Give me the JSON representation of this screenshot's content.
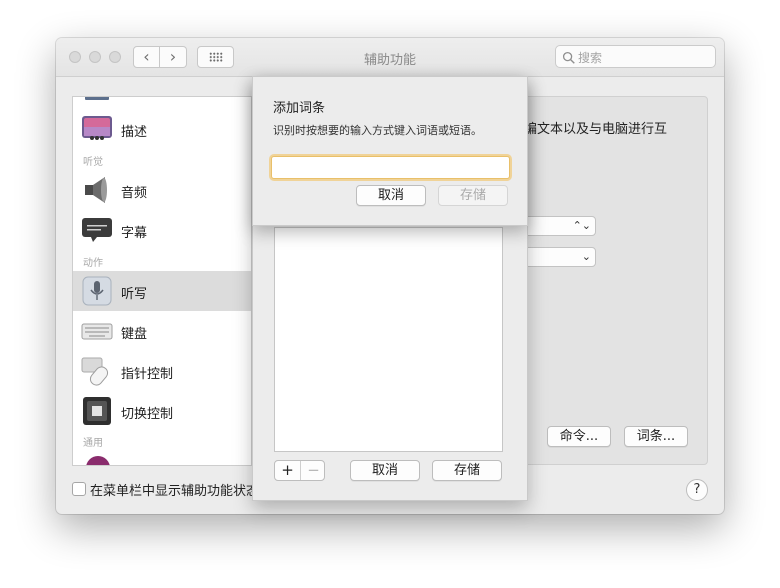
{
  "window": {
    "title": "辅助功能"
  },
  "toolbar": {
    "back_glyph": "‹",
    "forward_glyph": "›"
  },
  "search": {
    "placeholder": "搜索"
  },
  "sidebar": {
    "sections": {
      "vision": "听觉",
      "motor": "动作",
      "general": "通用"
    },
    "items": [
      {
        "label": "描述",
        "icon": "description-icon"
      },
      {
        "label": "音频",
        "icon": "speaker-icon"
      },
      {
        "label": "字幕",
        "icon": "captions-icon"
      },
      {
        "label": "听写",
        "icon": "microphone-icon",
        "selected": true
      },
      {
        "label": "键盘",
        "icon": "keyboard-icon"
      },
      {
        "label": "指针控制",
        "icon": "mouse-icon"
      },
      {
        "label": "切换控制",
        "icon": "switch-control-icon"
      }
    ]
  },
  "panel": {
    "description_fragment": "编文本以及与电脑进行互",
    "commands_button": "命令...",
    "vocabulary_button": "词条..."
  },
  "footer": {
    "menu_checkbox_label": "在菜单栏中显示辅助功能状态",
    "help_label": "?"
  },
  "vocab_sheet": {
    "add_symbol": "+",
    "remove_symbol": "−",
    "cancel_label": "取消",
    "save_label": "存储"
  },
  "add_dialog": {
    "title": "添加词条",
    "message": "识别时按想要的输入方式键入词语或短语。",
    "input_value": "",
    "cancel_label": "取消",
    "save_label": "存储"
  },
  "colors": {
    "focus_ring": "#f2c66c",
    "selected_row": "#dcdcdc"
  }
}
